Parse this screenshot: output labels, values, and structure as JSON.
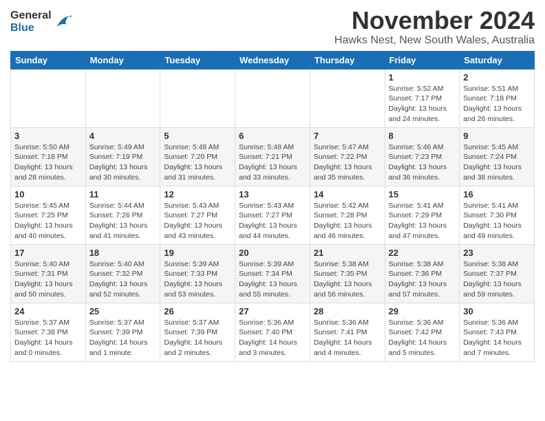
{
  "logo": {
    "general": "General",
    "blue": "Blue"
  },
  "title": "November 2024",
  "location": "Hawks Nest, New South Wales, Australia",
  "days_of_week": [
    "Sunday",
    "Monday",
    "Tuesday",
    "Wednesday",
    "Thursday",
    "Friday",
    "Saturday"
  ],
  "weeks": [
    [
      {
        "day": "",
        "info": ""
      },
      {
        "day": "",
        "info": ""
      },
      {
        "day": "",
        "info": ""
      },
      {
        "day": "",
        "info": ""
      },
      {
        "day": "",
        "info": ""
      },
      {
        "day": "1",
        "info": "Sunrise: 5:52 AM\nSunset: 7:17 PM\nDaylight: 13 hours\nand 24 minutes."
      },
      {
        "day": "2",
        "info": "Sunrise: 5:51 AM\nSunset: 7:18 PM\nDaylight: 13 hours\nand 26 minutes."
      }
    ],
    [
      {
        "day": "3",
        "info": "Sunrise: 5:50 AM\nSunset: 7:18 PM\nDaylight: 13 hours\nand 28 minutes."
      },
      {
        "day": "4",
        "info": "Sunrise: 5:49 AM\nSunset: 7:19 PM\nDaylight: 13 hours\nand 30 minutes."
      },
      {
        "day": "5",
        "info": "Sunrise: 5:48 AM\nSunset: 7:20 PM\nDaylight: 13 hours\nand 31 minutes."
      },
      {
        "day": "6",
        "info": "Sunrise: 5:48 AM\nSunset: 7:21 PM\nDaylight: 13 hours\nand 33 minutes."
      },
      {
        "day": "7",
        "info": "Sunrise: 5:47 AM\nSunset: 7:22 PM\nDaylight: 13 hours\nand 35 minutes."
      },
      {
        "day": "8",
        "info": "Sunrise: 5:46 AM\nSunset: 7:23 PM\nDaylight: 13 hours\nand 36 minutes."
      },
      {
        "day": "9",
        "info": "Sunrise: 5:45 AM\nSunset: 7:24 PM\nDaylight: 13 hours\nand 38 minutes."
      }
    ],
    [
      {
        "day": "10",
        "info": "Sunrise: 5:45 AM\nSunset: 7:25 PM\nDaylight: 13 hours\nand 40 minutes."
      },
      {
        "day": "11",
        "info": "Sunrise: 5:44 AM\nSunset: 7:26 PM\nDaylight: 13 hours\nand 41 minutes."
      },
      {
        "day": "12",
        "info": "Sunrise: 5:43 AM\nSunset: 7:27 PM\nDaylight: 13 hours\nand 43 minutes."
      },
      {
        "day": "13",
        "info": "Sunrise: 5:43 AM\nSunset: 7:27 PM\nDaylight: 13 hours\nand 44 minutes."
      },
      {
        "day": "14",
        "info": "Sunrise: 5:42 AM\nSunset: 7:28 PM\nDaylight: 13 hours\nand 46 minutes."
      },
      {
        "day": "15",
        "info": "Sunrise: 5:41 AM\nSunset: 7:29 PM\nDaylight: 13 hours\nand 47 minutes."
      },
      {
        "day": "16",
        "info": "Sunrise: 5:41 AM\nSunset: 7:30 PM\nDaylight: 13 hours\nand 49 minutes."
      }
    ],
    [
      {
        "day": "17",
        "info": "Sunrise: 5:40 AM\nSunset: 7:31 PM\nDaylight: 13 hours\nand 50 minutes."
      },
      {
        "day": "18",
        "info": "Sunrise: 5:40 AM\nSunset: 7:32 PM\nDaylight: 13 hours\nand 52 minutes."
      },
      {
        "day": "19",
        "info": "Sunrise: 5:39 AM\nSunset: 7:33 PM\nDaylight: 13 hours\nand 53 minutes."
      },
      {
        "day": "20",
        "info": "Sunrise: 5:39 AM\nSunset: 7:34 PM\nDaylight: 13 hours\nand 55 minutes."
      },
      {
        "day": "21",
        "info": "Sunrise: 5:38 AM\nSunset: 7:35 PM\nDaylight: 13 hours\nand 56 minutes."
      },
      {
        "day": "22",
        "info": "Sunrise: 5:38 AM\nSunset: 7:36 PM\nDaylight: 13 hours\nand 57 minutes."
      },
      {
        "day": "23",
        "info": "Sunrise: 5:38 AM\nSunset: 7:37 PM\nDaylight: 13 hours\nand 59 minutes."
      }
    ],
    [
      {
        "day": "24",
        "info": "Sunrise: 5:37 AM\nSunset: 7:38 PM\nDaylight: 14 hours\nand 0 minutes."
      },
      {
        "day": "25",
        "info": "Sunrise: 5:37 AM\nSunset: 7:39 PM\nDaylight: 14 hours\nand 1 minute."
      },
      {
        "day": "26",
        "info": "Sunrise: 5:37 AM\nSunset: 7:39 PM\nDaylight: 14 hours\nand 2 minutes."
      },
      {
        "day": "27",
        "info": "Sunrise: 5:36 AM\nSunset: 7:40 PM\nDaylight: 14 hours\nand 3 minutes."
      },
      {
        "day": "28",
        "info": "Sunrise: 5:36 AM\nSunset: 7:41 PM\nDaylight: 14 hours\nand 4 minutes."
      },
      {
        "day": "29",
        "info": "Sunrise: 5:36 AM\nSunset: 7:42 PM\nDaylight: 14 hours\nand 5 minutes."
      },
      {
        "day": "30",
        "info": "Sunrise: 5:36 AM\nSunset: 7:43 PM\nDaylight: 14 hours\nand 7 minutes."
      }
    ]
  ]
}
